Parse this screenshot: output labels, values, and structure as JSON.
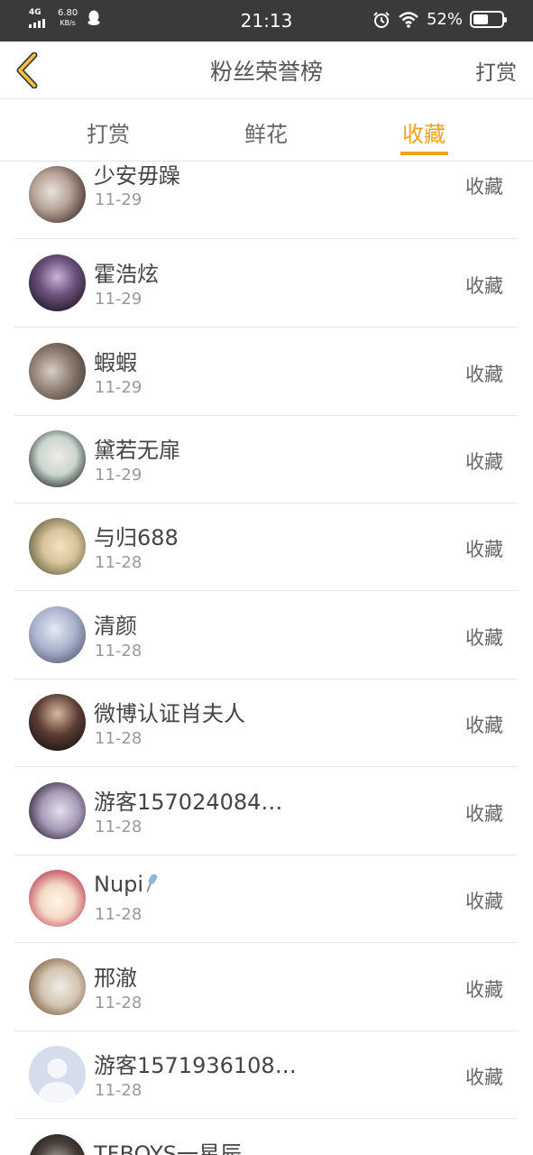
{
  "status_bar": {
    "network": "4G",
    "speed_value": "6.80",
    "speed_unit": "KB/s",
    "time": "21:13",
    "battery": "52%",
    "battery_level": 0.52,
    "icons": [
      "signal-icon",
      "qq-icon",
      "alarm-icon",
      "wifi-icon",
      "battery-icon"
    ]
  },
  "nav": {
    "title": "粉丝荣誉榜",
    "right_action": "打赏",
    "back_icon": "chevron-left-icon",
    "accent": "#f0a21c"
  },
  "tabs": [
    {
      "label": "打赏",
      "active": false
    },
    {
      "label": "鲜花",
      "active": false
    },
    {
      "label": "收藏",
      "active": true
    }
  ],
  "list": [
    {
      "name": "少安毋躁",
      "date": "11-29",
      "action": "收藏",
      "avatar": "avatar-photo"
    },
    {
      "name": "霍浩炫",
      "date": "11-29",
      "action": "收藏",
      "avatar": "avatar-photo"
    },
    {
      "name": "蝦蝦",
      "date": "11-29",
      "action": "收藏",
      "avatar": "avatar-photo"
    },
    {
      "name": "黛若无扉",
      "date": "11-29",
      "action": "收藏",
      "avatar": "avatar-photo"
    },
    {
      "name": "与归688",
      "date": "11-28",
      "action": "收藏",
      "avatar": "avatar-photo"
    },
    {
      "name": "清颜",
      "date": "11-28",
      "action": "收藏",
      "avatar": "avatar-photo"
    },
    {
      "name": "微博认证肖夫人",
      "date": "11-28",
      "action": "收藏",
      "avatar": "avatar-photo"
    },
    {
      "name": "游客157024084…",
      "date": "11-28",
      "action": "收藏",
      "avatar": "avatar-photo"
    },
    {
      "name": "Nupi",
      "date": "11-28",
      "action": "收藏",
      "avatar": "avatar-photo",
      "name_icon": "microphone-icon"
    },
    {
      "name": "邢澈",
      "date": "11-28",
      "action": "收藏",
      "avatar": "avatar-photo"
    },
    {
      "name": "游客1571936108…",
      "date": "11-28",
      "action": "收藏",
      "avatar": "avatar-default"
    },
    {
      "name": "TFBOYS一星辰",
      "date": "",
      "action": "",
      "avatar": "avatar-photo"
    }
  ]
}
